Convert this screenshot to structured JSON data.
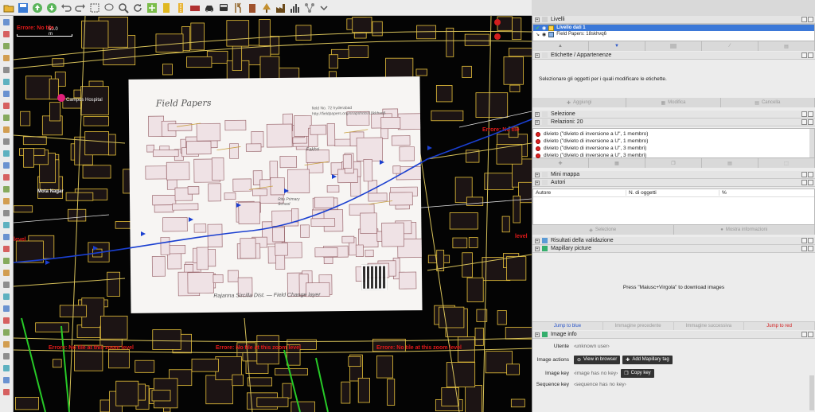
{
  "toolbar": {
    "icons": [
      "open-file",
      "save",
      "upload",
      "download",
      "undo",
      "redo",
      "select",
      "lasso",
      "zoom",
      "refresh",
      "preferences",
      "presets",
      "highway",
      "area",
      "car",
      "bus",
      "food",
      "building",
      "tree",
      "industry",
      "bar",
      "relation",
      "more"
    ]
  },
  "map": {
    "scale_label": "50.0 m",
    "poi_camp": "Campus Hospital",
    "poi_mota": "Mota Nagar",
    "error_text": "Errore: No tile at this zoom level",
    "error_short_left": "level",
    "error_short_right": "Errore: No tile",
    "background": "#040404",
    "accent_way": "#1a3fd0",
    "building_outline": "#e8c23a"
  },
  "paper": {
    "title": "Field Papers",
    "id_text": "field No. 72 hyderabad",
    "url_text": "http://fieldpapers.org/snapshots/18kkhvq6",
    "footer_text": "Rajanna Sircilla Dist. — Field Change layer",
    "handwrite_1": "Fakhri",
    "handwrite_2": "Ritu Primary School"
  },
  "panel": {
    "layers_title": "Livelli",
    "layer_1": "Livello dati 1",
    "layer_2": "Field Papers: 18skhvq6",
    "tags_title": "Etichette / Appartenenze",
    "tags_hint": "Selezionare gli oggetti per i quali modificare le etichette.",
    "btn_add": "Aggiungi",
    "btn_edit": "Modifica",
    "btn_delete": "Cancella",
    "selection_title": "Selezione",
    "relations_title": "Relazioni: 20",
    "relations": [
      "divieto (\"divieto di inversione a U\", 1 membro)",
      "divieto (\"divieto di inversione a U\", 1 membro)",
      "divieto (\"divieto di inversione a U\", 3 membri)",
      "divieto (\"divieto di inversione a U\", 3 membri)"
    ],
    "minimap_title": "Mini mappa",
    "authors_title": "Autori",
    "col_author": "Autore",
    "col_count": "N. di oggetti",
    "col_pct": "%",
    "btn_selection": "Selezione",
    "btn_show_info": "Mostra informazioni",
    "validation_title": "Risultati della validazione",
    "mapillary_title": "Mapillary picture",
    "mapillary_hint": "Press \"Maiusc+Virgola\" to download images",
    "nav_blue": "Jump to blue",
    "nav_prev": "Immagine precedente",
    "nav_next": "Immagine successiva",
    "nav_red": "Jump to red",
    "image_info_title": "Image info",
    "label_user": "Utente",
    "value_user": "‹unknown user›",
    "label_actions": "Image actions",
    "btn_view_browser": "View in browser",
    "btn_add_tag": "Add Mapillary tag",
    "label_image_key": "Image key",
    "value_image_key": "‹image has no key›",
    "btn_copy_key": "Copy key",
    "label_sequence_key": "Sequence key",
    "value_sequence_key": "‹sequence has no key›",
    "color_blue": "#2a55c8",
    "color_red": "#d21e1e"
  }
}
